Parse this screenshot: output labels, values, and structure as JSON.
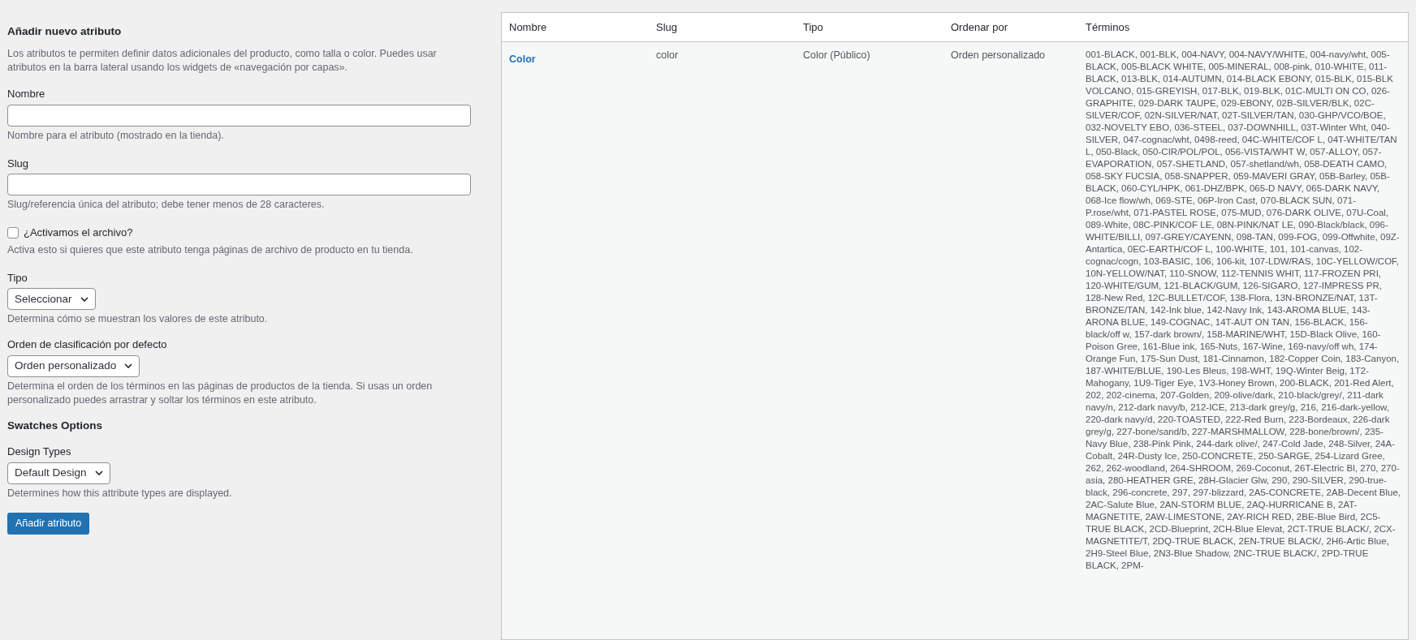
{
  "form": {
    "title": "Añadir nuevo atributo",
    "intro": "Los atributos te permiten definir datos adicionales del producto, como talla o color. Puedes usar atributos en la barra lateral usando los widgets de «navegación por capas».",
    "fields": [
      {
        "kind": "text",
        "label": "Nombre",
        "description": "Nombre para el atributo (mostrado en la tienda)."
      },
      {
        "kind": "text",
        "label": "Slug",
        "description": "Slug/referencia única del atributo; debe tener menos de 28 caracteres."
      },
      {
        "kind": "checkbox",
        "label": "¿Activamos el archivo?",
        "checked": false,
        "description": "Activa esto si quieres que este atributo tenga páginas de archivo de producto en tu tienda."
      },
      {
        "kind": "select",
        "label": "Tipo",
        "value": "Seleccionar",
        "description": "Determina cómo se muestran los valores de este atributo."
      },
      {
        "kind": "select",
        "label": "Orden de clasificación por defecto",
        "value": "Orden personalizado",
        "description": "Determina el orden de los términos en las páginas de productos de la tienda. Si usas un orden personalizado puedes arrastrar y soltar los términos en este atributo."
      },
      {
        "kind": "heading",
        "label": "Swatches Options"
      },
      {
        "kind": "select",
        "label": "Design Types",
        "value": "Default Design",
        "description": "Determines how this attribute types are displayed."
      }
    ],
    "submit": "Añadir atributo"
  },
  "table": {
    "columns": [
      "Nombre",
      "Slug",
      "Tipo",
      "Ordenar por",
      "Términos"
    ],
    "rows": [
      {
        "name": "Color",
        "slug": "color",
        "type": "Color (Público)",
        "order": "Orden personalizado",
        "terms": "001-BLACK, 001-BLK, 004-NAVY, 004-NAVY/WHITE, 004-navy/wht, 005-BLACK, 005-BLACK WHITE, 005-MINERAL, 008-pink, 010-WHITE, 011-BLACK, 013-BLK, 014-AUTUMN, 014-BLACK EBONY, 015-BLK, 015-BLK VOLCANO, 015-GREYISH, 017-BLK, 019-BLK, 01C-MULTI ON CO, 026-GRAPHITE, 029-DARK TAUPE, 029-EBONY, 02B-SILVER/BLK, 02C-SILVER/COF, 02N-SILVER/NAT, 02T-SILVER/TAN, 030-GHP/VCO/BOE, 032-NOVELTY EBO, 036-STEEL, 037-DOWNHILL, 03T-Winter Wht, 040-SILVER, 047-cognac/wht, 0498-reed, 04C-WHITE/COF L, 04T-WHITE/TAN L, 050-Black, 050-CIR/POL/POL, 056-VISTA/WHT W, 057-ALLOY, 057-EVAPORATION, 057-SHETLAND, 057-shetland/wh, 058-DEATH CAMO, 058-SKY FUCSIA, 058-SNAPPER, 059-MAVERI GRAY, 05B-Barley, 05B-BLACK, 060-CYL/HPK, 061-DHZ/BPK, 065-D NAVY, 065-DARK NAVY, 068-Ice flow/wh, 069-STE, 06P-Iron Cast, 070-BLACK SUN, 071-P.rose/wht, 071-PASTEL ROSE, 075-MUD, 076-DARK OLIVE, 07U-Coal, 089-White, 08C-PINK/COF LE, 08N-PINK/NAT LE, 090-Black/black, 096-WHITE/BILLI, 097-GREY/CAYENN, 098-TAN, 099-FOG, 099-Offwhite, 09Z-Antartica, 0EC-EARTH/COF L, 100-WHITE, 101, 101-canvas, 102-cognac/cogn, 103-BASIC, 106, 106-kit, 107-LDW/RAS, 10C-YELLOW/COF, 10N-YELLOW/NAT, 110-SNOW, 112-TENNIS WHIT, 117-FROZEN PRI, 120-WHITE/GUM, 121-BLACK/GUM, 126-SIGARO, 127-IMPRESS PR, 128-New Red, 12C-BULLET/COF, 138-Flora, 13N-BRONZE/NAT, 13T-BRONZE/TAN, 142-Ink blue, 142-Navy Ink, 143-AROMA BLUE, 143-ARONA BLUE, 149-COGNAC, 14T-AUT ON TAN, 156-BLACK, 156-black/off w, 157-dark brown/, 158-MARINE/WHT, 15D-Black Olive, 160-Poison Gree, 161-Blue ink, 165-Nuts, 167-Wine, 169-navy/off wh, 174-Orange Fun, 175-Sun Dust, 181-Cinnamon, 182-Copper Coin, 183-Canyon, 187-WHITE/BLUE, 190-Les Bleus, 198-WHT, 19Q-Winter Beig, 1T2-Mahogany, 1U9-Tiger Eye, 1V3-Honey Brown, 200-BLACK, 201-Red Alert, 202, 202-cinema, 207-Golden, 209-olive/dark, 210-black/grey/, 211-dark navy/n, 212-dark navy/b, 212-ICE, 213-dark grey/g, 216, 216-dark-yellow, 220-dark navy/d, 220-TOASTED, 222-Red Burn, 223-Bordeaux, 226-dark grey/g, 227-bone/sand/b, 227-MARSHMALLOW, 228-bone/brown/, 235-Navy Blue, 238-Pink Pink, 244-dark olive/, 247-Cold Jade, 248-Silver, 24A-Cobalt, 24R-Dusty Ice, 250-CONCRETE, 250-SARGE, 254-Lizard Gree, 262, 262-woodland, 264-SHROOM, 269-Coconut, 26T-Electric Bl, 270, 270-asia, 280-HEATHER GRE, 28H-Glacier Glw, 290, 290-SILVER, 290-true-black, 296-concrete, 297, 297-blizzard, 2A5-CONCRETE, 2AB-Decent Blue, 2AC-Salute Blue, 2AN-STORM BLUE, 2AQ-HURRICANE B, 2AT-MAGNETITE, 2AW-LIMESTONE, 2AY-RICH RED, 2BE-Blue Bird, 2C5-TRUE BLACK, 2CD-Blueprint, 2CH-Blue Elevat, 2CT-TRUE BLACK/, 2CX-MAGNETITE/T, 2DQ-TRUE BLACK, 2EN-TRUE BLACK/, 2H6-Artic Blue, 2H9-Steel Blue, 2N3-Blue Shadow, 2NC-TRUE BLACK/, 2PD-TRUE BLACK, 2PM-"
      }
    ]
  }
}
